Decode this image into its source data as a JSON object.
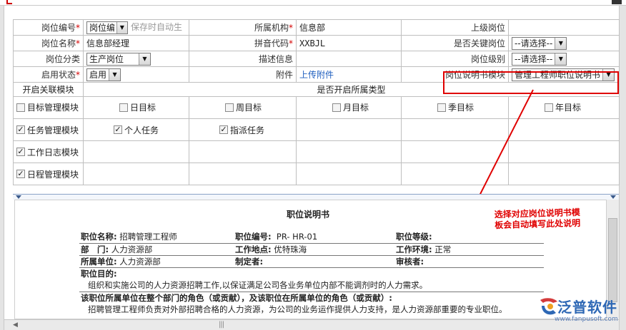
{
  "form": {
    "position_code_label": "岗位编号",
    "position_code_value": "岗位编",
    "position_code_hint": "保存时自动生",
    "org_label": "所属机构",
    "org_value": "信息部",
    "superior_label": "上级岗位",
    "position_name_label": "岗位名称",
    "position_name_value": "信息部经理",
    "pinyin_label": "拼音代码",
    "pinyin_value": "XXBJL",
    "key_position_label": "是否关键岗位",
    "key_position_value": "--请选择--",
    "category_label": "岗位分类",
    "category_value": "生产岗位",
    "description_label": "描述信息",
    "level_label": "岗位级别",
    "level_value": "--请选择--",
    "status_label": "启用状态",
    "status_value": "启用",
    "attachment_label": "附件",
    "attachment_link": "上传附件",
    "template_label": "岗位说明书模块",
    "template_value": "管理工程师职位说明书",
    "modules_header": "开启关联模块",
    "types_header": "是否开启所属类型",
    "required_mark": "*"
  },
  "modules": [
    {
      "label": "目标管理模块",
      "checked": false,
      "types": [
        {
          "label": "日目标",
          "checked": false
        },
        {
          "label": "周目标",
          "checked": false
        },
        {
          "label": "月目标",
          "checked": false
        },
        {
          "label": "季目标",
          "checked": false
        },
        {
          "label": "年目标",
          "checked": false
        }
      ]
    },
    {
      "label": "任务管理模块",
      "checked": true,
      "types": [
        {
          "label": "个人任务",
          "checked": true
        },
        {
          "label": "指派任务",
          "checked": true
        }
      ]
    },
    {
      "label": "工作日志模块",
      "checked": true,
      "types": []
    },
    {
      "label": "日程管理模块",
      "checked": true,
      "types": []
    }
  ],
  "annotation": {
    "line1": "选择对应岗位说明书模",
    "line2": "板会自动填写此处说明"
  },
  "document": {
    "title": "职位说明书",
    "job_name_label": "职位名称:",
    "job_name_value": "招聘管理工程师",
    "job_code_label": "职位编号:",
    "job_code_value": "PR- HR-01",
    "job_grade_label": "职位等级:",
    "dept_label": "部　门:",
    "dept_value": "人力资源部",
    "location_label": "工作地点:",
    "location_value": "优特珠海",
    "environment_label": "工作环境:",
    "environment_value": "正常",
    "unit_label": "所属单位:",
    "unit_value": "人力资源部",
    "author_label": "制定者:",
    "reviewer_label": "审核者:",
    "purpose_label": "职位目的:",
    "purpose_text": "组织和实施公司的人力资源招聘工作,以保证满足公司各业务单位内部不能调剂时的人力需求。",
    "role_label": "该职位所属单位在整个部门的角色（或贡献），及该职位在所属单位的角色（或贡献）:",
    "role_text": "招聘管理工程师负责对外部招聘合格的人力资源，为公司的业务运作提供人力支持，是人力资源部重要的专业职位。"
  },
  "brand": {
    "name": "泛普软件",
    "url": "www.fanpusoft.com"
  }
}
